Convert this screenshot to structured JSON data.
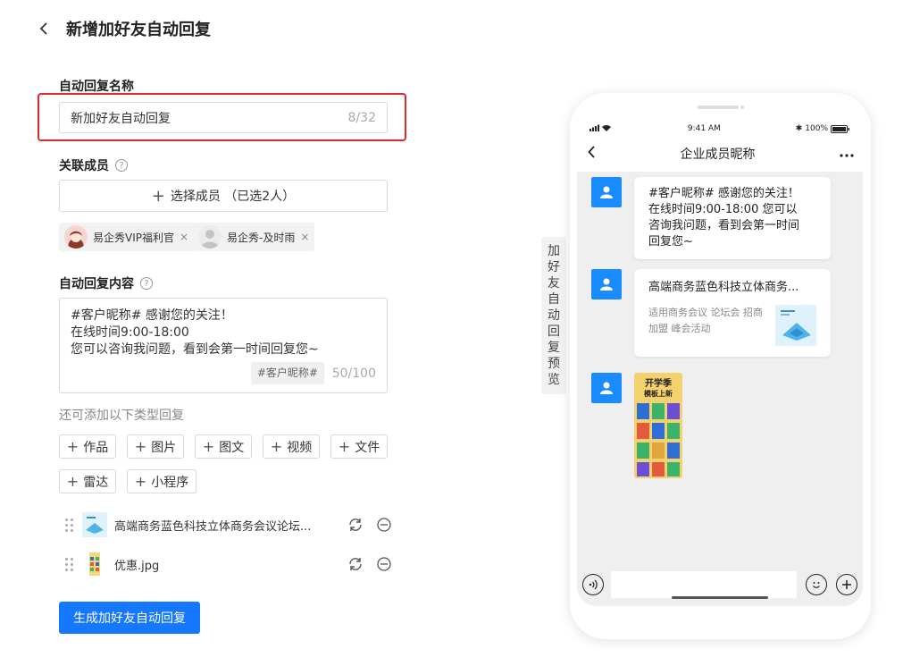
{
  "header": {
    "title": "新增加好友自动回复"
  },
  "form": {
    "name_label": "自动回复名称",
    "name_value": "新加好友自动回复",
    "name_count": "8/32",
    "members_label": "关联成员",
    "select_members": "选择成员 （已选2人）",
    "members": [
      {
        "name": "易企秀VIP福利官"
      },
      {
        "name": "易企秀-及时雨"
      }
    ],
    "content_label": "自动回复内容",
    "content_lines": [
      "#客户昵称# 感谢您的关注！",
      "在线时间9:00-18:00",
      "您可以咨询我问题，看到会第一时间回复您~"
    ],
    "content_tag": "#客户昵称#",
    "content_count": "50/100",
    "add_hint": "还可添加以下类型回复",
    "add_types": [
      "作品",
      "图片",
      "图文",
      "视频",
      "文件",
      "雷达",
      "小程序"
    ],
    "attachments": [
      {
        "name": "高端商务蓝色科技立体商务会议论坛..."
      },
      {
        "name": "优惠.jpg"
      }
    ],
    "submit": "生成加好友自动回复"
  },
  "preview": {
    "tab_chars": [
      "加",
      "好",
      "友",
      "自",
      "动",
      "回",
      "复",
      "预",
      "览"
    ],
    "status_time": "9:41 AM",
    "battery": "100%",
    "chat_title": "企业成员昵称",
    "msg1_lines": [
      "#客户昵称# 感谢您的关注！",
      "在线时间9:00-18:00 您可以",
      "咨询我问题，看到会第一时间",
      "回复您~"
    ],
    "card_title": "高端商务蓝色科技立体商务...",
    "card_desc": "适用商务会议 论坛会 招商加盟 峰会活动",
    "poster_title_1": "开学季",
    "poster_title_2": "模板上新"
  },
  "colors": {
    "primary": "#1677ff",
    "highlight": "#e0262e",
    "avatar": "#1a8cff"
  }
}
